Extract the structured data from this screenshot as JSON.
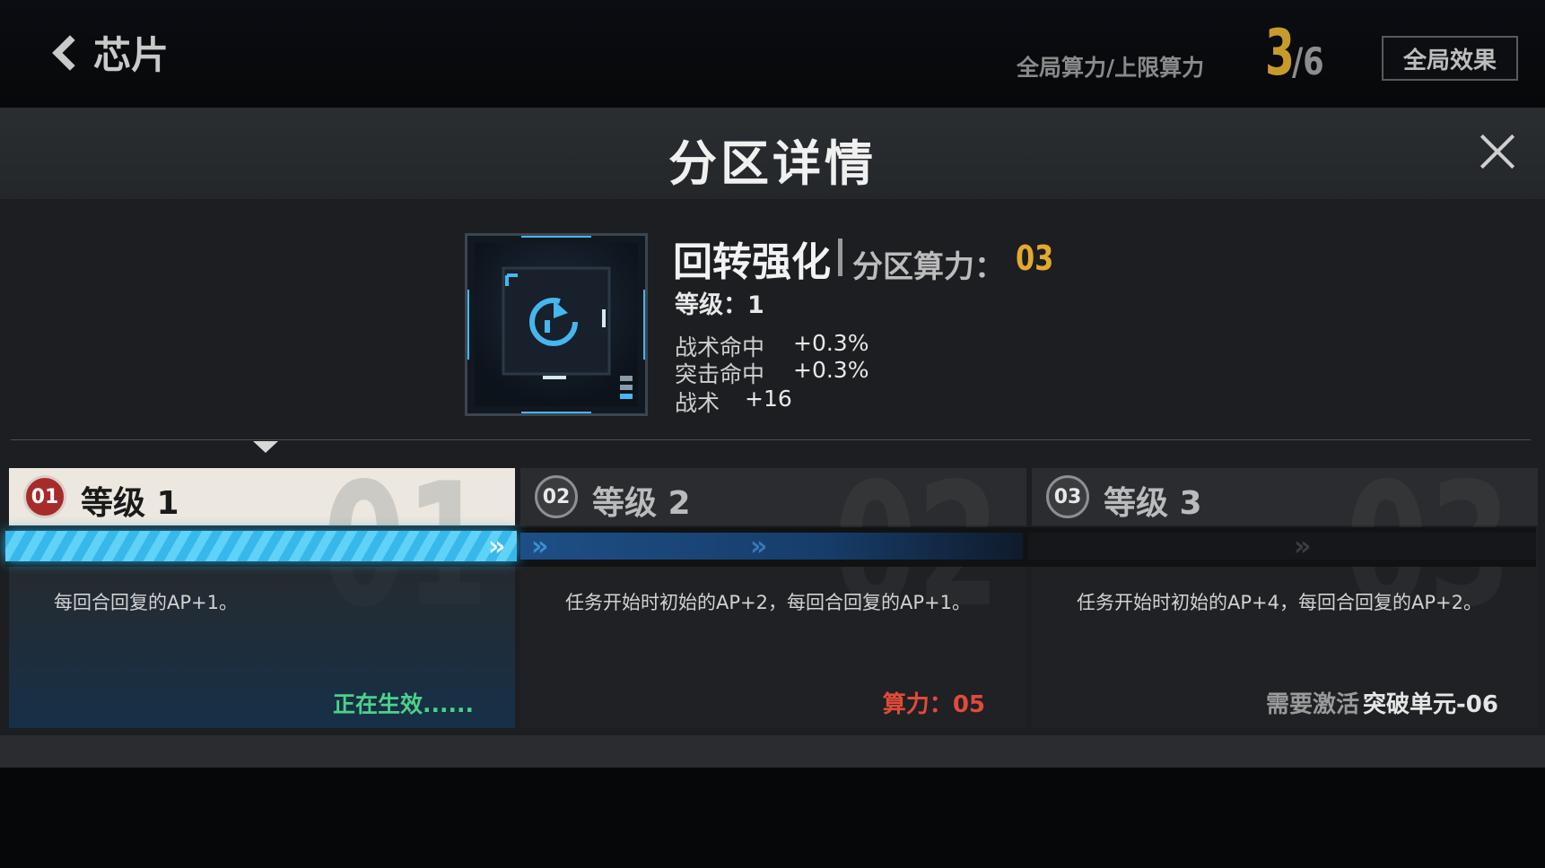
{
  "nav": {
    "back_label": "芯片"
  },
  "global": {
    "label": "全局算力/上限算力",
    "current": "3",
    "max": "/6",
    "effect_button": "全局效果"
  },
  "panel": {
    "title": "分区详情"
  },
  "chip": {
    "name": "回转强化",
    "power_label": "分区算力：",
    "power_value": "03",
    "level_label": "等级：",
    "level_value": "1",
    "stats": [
      {
        "name": "战术命中",
        "value": "+0.3%"
      },
      {
        "name": "突击命中",
        "value": "+0.3%"
      },
      {
        "name": "战术",
        "value": "+16"
      }
    ]
  },
  "levels": [
    {
      "badge": "01",
      "title": "等级 1",
      "big": "01",
      "desc": "每回合回复的AP+1。",
      "status": "正在生效......"
    },
    {
      "badge": "02",
      "title": "等级 2",
      "big": "02",
      "desc": "任务开始时初始的AP+2，每回合回复的AP+1。",
      "power_label": "算力：",
      "power_value": "05"
    },
    {
      "badge": "03",
      "title": "等级 3",
      "big": "03",
      "desc": "任务开始时初始的AP+4，每回合回复的AP+2。",
      "need_label": "需要激活",
      "need_unit": "突破单元-06"
    }
  ],
  "colors": {
    "accent_gold": "#e3a92f",
    "progress_cyan": "#37b8ea",
    "active_green": "#4bd18a",
    "power_red": "#e24a3a"
  }
}
